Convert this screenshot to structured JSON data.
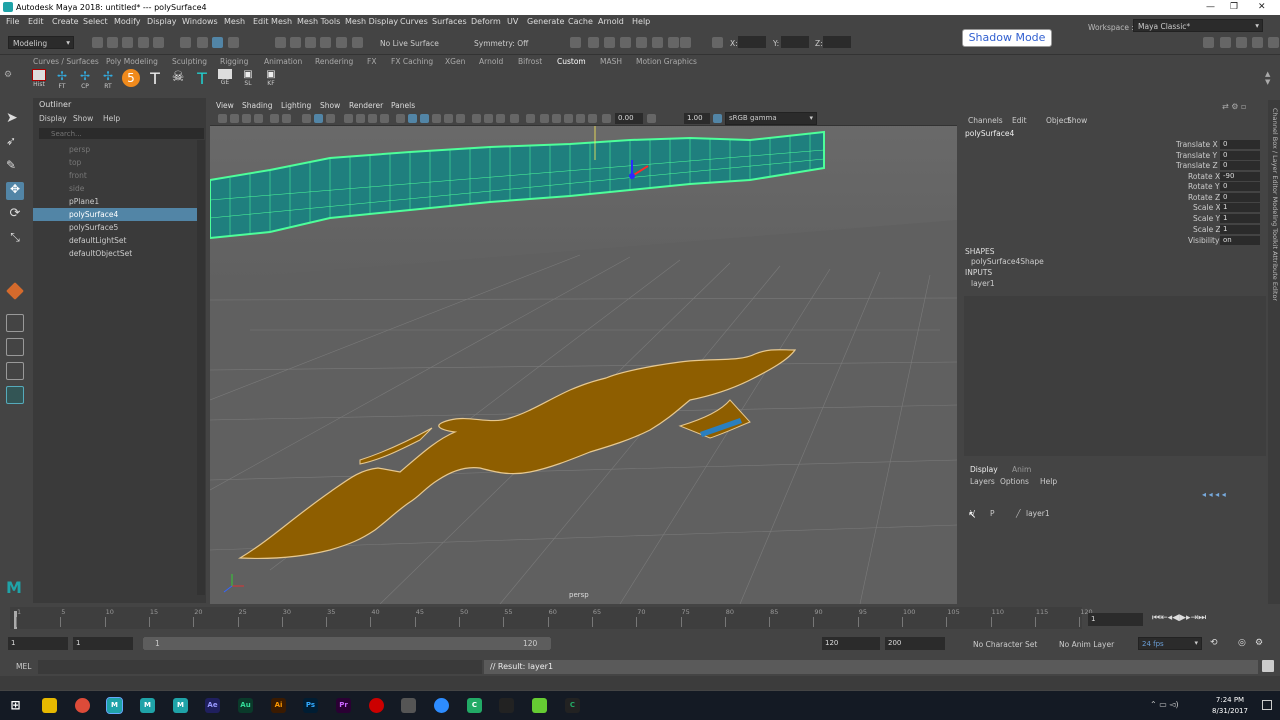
{
  "window": {
    "title": "Autodesk Maya 2018: untitled*   ---   polySurface4",
    "min": "—",
    "max": "❐",
    "close": "✕"
  },
  "menu": [
    "File",
    "Edit",
    "Create",
    "Select",
    "Modify",
    "Display",
    "Windows",
    "Mesh",
    "Edit Mesh",
    "Mesh Tools",
    "Mesh Display",
    "Curves",
    "Surfaces",
    "Deform",
    "UV",
    "Generate",
    "Cache",
    "Arnold",
    "Help"
  ],
  "status": {
    "mode": "Modeling",
    "live_surface": "No Live Surface",
    "symmetry": "Symmetry: Off",
    "x_label": "X:",
    "y_label": "Y:",
    "z_label": "Z:",
    "shadow_mode": "Shadow Mode",
    "workspace_label": "Workspace :",
    "workspace_value": "Maya Classic*"
  },
  "shelf_tabs": [
    "Curves / Surfaces",
    "Poly Modeling",
    "Sculpting",
    "Rigging",
    "Animation",
    "Rendering",
    "FX",
    "FX Caching",
    "XGen",
    "Arnold",
    "Bifrost",
    "Custom",
    "MASH",
    "Motion Graphics"
  ],
  "shelf_icons": [
    "Hist",
    "FT",
    "CP",
    "RT",
    "5",
    "",
    "",
    "GE",
    "SL",
    "KF"
  ],
  "outliner": {
    "title": "Outliner",
    "menu": [
      "Display",
      "Show",
      "Help"
    ],
    "search_placeholder": "Search...",
    "items": [
      "persp",
      "top",
      "front",
      "side",
      "pPlane1",
      "polySurface4",
      "polySurface5",
      "defaultLightSet",
      "defaultObjectSet"
    ],
    "selected": "polySurface4"
  },
  "viewport": {
    "menu": [
      "View",
      "Shading",
      "Lighting",
      "Show",
      "Renderer",
      "Panels"
    ],
    "exposure": "0.00",
    "gamma": "1.00",
    "color_space": "sRGB gamma",
    "camera_label": "persp"
  },
  "channelbox": {
    "menu": [
      "Channels",
      "Edit",
      "Object",
      "Show"
    ],
    "object": "polySurface4",
    "attrs": [
      {
        "name": "Translate X",
        "value": "0"
      },
      {
        "name": "Translate Y",
        "value": "0"
      },
      {
        "name": "Translate Z",
        "value": "0"
      },
      {
        "name": "Rotate X",
        "value": "-90"
      },
      {
        "name": "Rotate Y",
        "value": "0"
      },
      {
        "name": "Rotate Z",
        "value": "0"
      },
      {
        "name": "Scale X",
        "value": "1"
      },
      {
        "name": "Scale Y",
        "value": "1"
      },
      {
        "name": "Scale Z",
        "value": "1"
      },
      {
        "name": "Visibility",
        "value": "on"
      }
    ],
    "shapes_header": "SHAPES",
    "shape": "polySurface4Shape",
    "inputs_header": "INPUTS",
    "input": "layer1"
  },
  "right_tabs": "Channel Box / Layer Editor   Modeling Toolkit   Attribute Editor",
  "layers": {
    "tabs": [
      "Display",
      "Anim"
    ],
    "menu": [
      "Layers",
      "Options",
      "Help"
    ],
    "row": {
      "v": "V",
      "p": "P",
      "name": "layer1"
    }
  },
  "timeline": {
    "ticks": [
      "1",
      "5",
      "10",
      "15",
      "20",
      "25",
      "30",
      "35",
      "40",
      "45",
      "50",
      "55",
      "60",
      "65",
      "70",
      "75",
      "80",
      "85",
      "90",
      "95",
      "100",
      "105",
      "110",
      "115",
      "120"
    ],
    "current_frame": "1",
    "range_start": "1",
    "range_inner_start": "1",
    "range_slider_start": "1",
    "range_slider_end": "120",
    "range_end": "120",
    "anim_end": "200",
    "character_set": "No Character Set",
    "anim_layer": "No Anim Layer",
    "fps": "24 fps"
  },
  "cmdline": {
    "lang": "MEL",
    "result": "// Result: layer1"
  },
  "taskbar": {
    "time": "7:24 PM",
    "date": "8/31/2017"
  },
  "colors": {
    "selected": "#5285a6",
    "wire": "#4dff9a",
    "mesh": "#1f7f7e",
    "text3d": "#8e5e00",
    "floor": "#6a6a6a"
  }
}
